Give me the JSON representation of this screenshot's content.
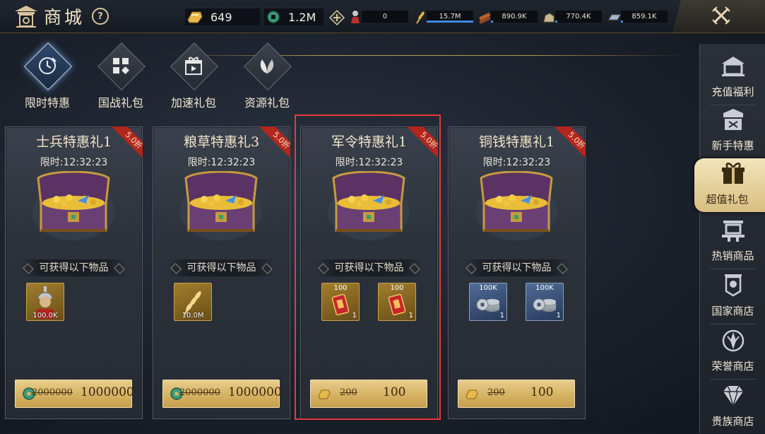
{
  "header": {
    "title": "商城",
    "help_label": "?",
    "gold": "649",
    "coins": "1.2M"
  },
  "resources": [
    {
      "name": "troops",
      "icon": "soldier-icon",
      "value": "0",
      "fill": 0.0
    },
    {
      "name": "grain",
      "icon": "wheat-icon",
      "value": "15.7M",
      "fill": 1.0
    },
    {
      "name": "wood",
      "icon": "wood-icon",
      "value": "890.9K",
      "fill": 0.05
    },
    {
      "name": "stone",
      "icon": "stone-icon",
      "value": "770.4K",
      "fill": 0.04
    },
    {
      "name": "iron",
      "icon": "iron-icon",
      "value": "859.1K",
      "fill": 0.05
    }
  ],
  "categories": [
    {
      "label": "限时特惠",
      "icon": "limited-deal-icon",
      "active": true
    },
    {
      "label": "国战礼包",
      "icon": "war-pack-icon",
      "active": false
    },
    {
      "label": "加速礼包",
      "icon": "speedup-pack-icon",
      "active": false
    },
    {
      "label": "资源礼包",
      "icon": "resource-pack-icon",
      "active": false
    }
  ],
  "cards": [
    {
      "name": "士兵特惠礼1",
      "discount": "5.0折",
      "timer": "限时:12:32:23",
      "items_label": "可获得以下物品",
      "items": [
        {
          "type": "soldier",
          "amount": "100.0K"
        }
      ],
      "price_old": "2000000",
      "price_new": "1000000",
      "currency": "copper-coin-icon"
    },
    {
      "name": "粮草特惠礼3",
      "discount": "5.0折",
      "timer": "限时:12:32:23",
      "items_label": "可获得以下物品",
      "items": [
        {
          "type": "grain",
          "amount": "10.0M"
        }
      ],
      "price_old": "2000000",
      "price_new": "1000000",
      "currency": "copper-coin-icon"
    },
    {
      "name": "军令特惠礼1",
      "discount": "5.0折",
      "timer": "限时:12:32:23",
      "items_label": "可获得以下物品",
      "items": [
        {
          "type": "order",
          "top": "100",
          "qty": "1"
        },
        {
          "type": "order",
          "top": "100",
          "qty": "1"
        }
      ],
      "price_old": "200",
      "price_new": "100",
      "currency": "gold-ingot-icon"
    },
    {
      "name": "铜钱特惠礼1",
      "discount": "5.0折",
      "timer": "限时:12:32:23",
      "items_label": "可获得以下物品",
      "items": [
        {
          "type": "coins",
          "top": "100K",
          "qty": "1"
        },
        {
          "type": "coins",
          "top": "100K",
          "qty": "1"
        }
      ],
      "price_old": "200",
      "price_new": "100",
      "currency": "gold-ingot-icon"
    }
  ],
  "sidebar": [
    {
      "label": "充值福利",
      "icon": "recharge-icon",
      "active": false
    },
    {
      "label": "新手特惠",
      "icon": "newbie-icon",
      "active": false
    },
    {
      "label": "超值礼包",
      "icon": "gift-pack-icon",
      "active": true
    },
    {
      "label": "热销商品",
      "icon": "hot-sale-icon",
      "active": false
    },
    {
      "label": "国家商店",
      "icon": "nation-shop-icon",
      "active": false
    },
    {
      "label": "荣誉商店",
      "icon": "honor-shop-icon",
      "active": false
    },
    {
      "label": "贵族商店",
      "icon": "noble-shop-icon",
      "active": false
    }
  ]
}
